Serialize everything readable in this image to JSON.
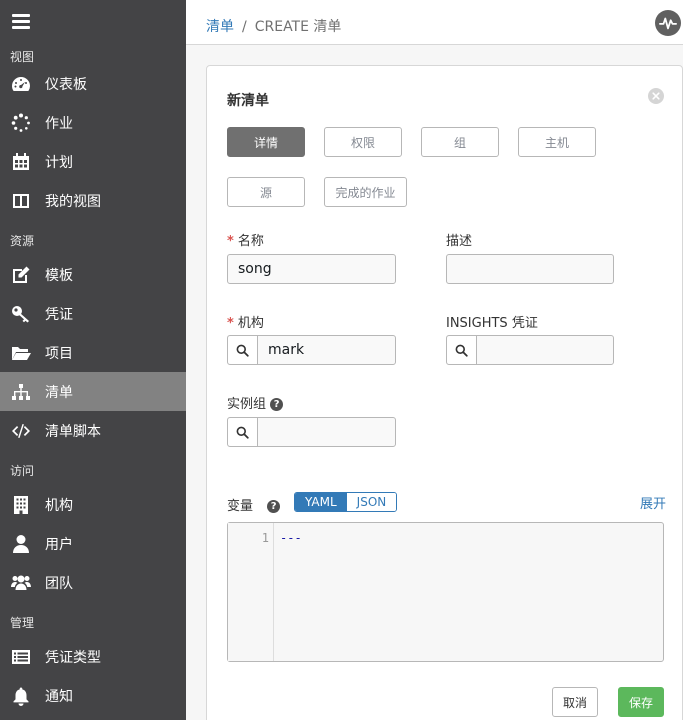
{
  "sidebar": {
    "sections": {
      "views": "视图",
      "resources": "资源",
      "access": "访问",
      "admin": "管理"
    },
    "items": {
      "dashboard": "仪表板",
      "jobs": "作业",
      "schedules": "计划",
      "my_view": "我的视图",
      "templates": "模板",
      "credentials": "凭证",
      "projects": "项目",
      "inventories": "清单",
      "inventory_scripts": "清单脚本",
      "organizations": "机构",
      "users": "用户",
      "teams": "团队",
      "credential_types": "凭证类型",
      "notifications": "通知"
    }
  },
  "breadcrumb": {
    "root": "清单",
    "separator": "/",
    "current": "CREATE 清单"
  },
  "form": {
    "title": "新清单",
    "tabs": {
      "details": "详情",
      "permissions": "权限",
      "groups": "组",
      "hosts": "主机",
      "sources": "源",
      "completed_jobs": "完成的作业"
    },
    "name_label": "名称",
    "name_value": "song",
    "description_label": "描述",
    "description_value": "",
    "organization_label": "机构",
    "organization_value": "mark",
    "insights_label": "INSIGHTS 凭证",
    "insights_value": "",
    "instance_groups_label": "实例组",
    "instance_groups_value": "",
    "variables_label": "变量",
    "yaml_label": "YAML",
    "json_label": "JSON",
    "expand_label": "展开",
    "editor_line_number": "1",
    "editor_content": "---",
    "cancel_label": "取消",
    "save_label": "保存"
  },
  "colors": {
    "sidebar_bg": "#444446",
    "sidebar_active": "#828282",
    "link": "#337ab7",
    "save": "#5cb85c",
    "required": "#d9534f"
  }
}
